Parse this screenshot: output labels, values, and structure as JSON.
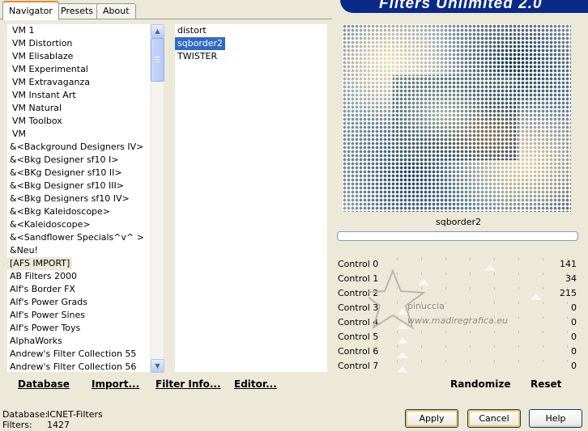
{
  "tabs": [
    "Navigator",
    "Presets",
    "About"
  ],
  "banner_title": "Filters Unlimited 2.0",
  "categories": [
    "VM 1",
    "VM Distortion",
    "VM Elisablaze",
    "VM Experimental",
    "VM Extravaganza",
    "VM Instant Art",
    "VM Natural",
    "VM Toolbox",
    "VM",
    "&<Background Designers IV>",
    "&<Bkg Designer sf10 I>",
    "&<BKg Designer sf10 II>",
    "&<Bkg Designer sf10 III>",
    "&<Bkg Designers sf10 IV>",
    "&<Bkg Kaleidoscope>",
    "&<Kaleidoscope>",
    "&<Sandflower Specials^v^ >",
    "&Neu!",
    "[AFS IMPORT]",
    "AB Filters 2000",
    "Alf's Border FX",
    "Alf's Power Grads",
    "Alf's Power Sines",
    "Alf's Power Toys",
    "AlphaWorks",
    "Andrew's Filter Collection 55",
    "Andrew's Filter Collection 56"
  ],
  "selected_category": "[AFS IMPORT]",
  "filters": [
    "distort",
    "sqborder2",
    "TWISTER"
  ],
  "selected_filter": "sqborder2",
  "bottom_buttons": {
    "database": "Database",
    "import": "Import...",
    "filter_info": "Filter Info...",
    "editor": "Editor..."
  },
  "preview": {
    "filter_name": "sqborder2"
  },
  "controls": [
    {
      "label": "Control 0",
      "value": "141"
    },
    {
      "label": "Control 1",
      "value": "34"
    },
    {
      "label": "Control 2",
      "value": "215"
    },
    {
      "label": "Control 3",
      "value": "0"
    },
    {
      "label": "Control 4",
      "value": "0"
    },
    {
      "label": "Control 5",
      "value": "0"
    },
    {
      "label": "Control 6",
      "value": "0"
    },
    {
      "label": "Control 7",
      "value": "0"
    }
  ],
  "randomize_label": "Randomize",
  "reset_label": "Reset",
  "status": {
    "database_label": "Database:",
    "database_value": "ICNET-Filters",
    "filters_label": "Filters:",
    "filters_value": "1427"
  },
  "dialog_buttons": {
    "apply": "Apply",
    "cancel": "Cancel",
    "help": "Help"
  },
  "watermark": {
    "name": "pinuccia",
    "url": "www.madiregrafica.eu"
  }
}
